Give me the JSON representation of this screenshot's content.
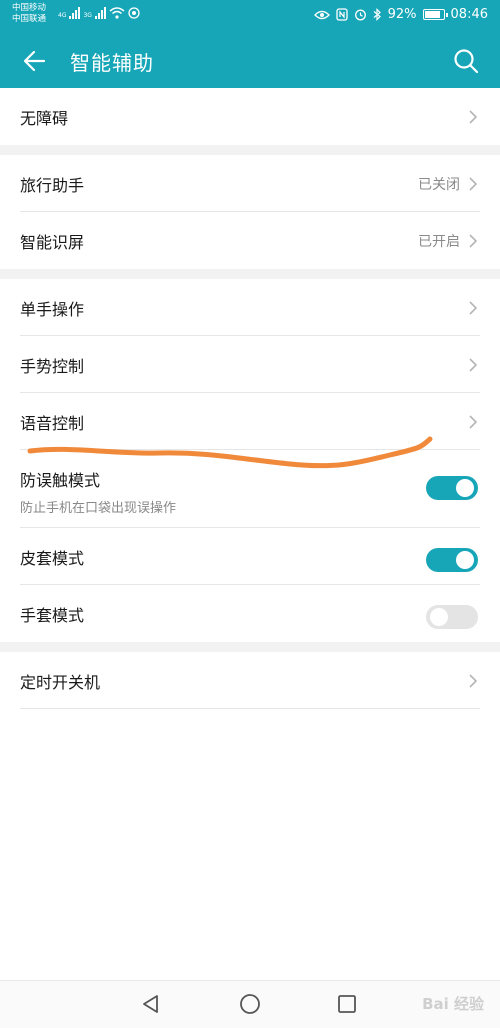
{
  "status_bar": {
    "carrier_1": "中国移动",
    "carrier_2": "中国联通",
    "net_1": "4G",
    "net_2": "3G",
    "battery_text": "92%",
    "time": "08:46"
  },
  "app_bar": {
    "title": "智能辅助",
    "back_icon": "arrow-left",
    "search_icon": "search"
  },
  "sections": [
    {
      "items": [
        {
          "label": "无障碍",
          "type": "link"
        }
      ]
    },
    {
      "items": [
        {
          "label": "旅行助手",
          "value": "已关闭",
          "type": "link"
        },
        {
          "label": "智能识屏",
          "value": "已开启",
          "type": "link"
        }
      ]
    },
    {
      "items": [
        {
          "label": "单手操作",
          "type": "link"
        },
        {
          "label": "手势控制",
          "type": "link"
        },
        {
          "label": "语音控制",
          "type": "link"
        },
        {
          "label": "防误触模式",
          "sublabel": "防止手机在口袋出现误操作",
          "type": "toggle",
          "on": true
        },
        {
          "label": "皮套模式",
          "type": "toggle",
          "on": true
        },
        {
          "label": "手套模式",
          "type": "toggle",
          "on": false
        }
      ]
    },
    {
      "items": [
        {
          "label": "定时开关机",
          "type": "link"
        }
      ]
    }
  ],
  "nav_bar": {
    "watermark": "Bai 经验"
  },
  "colors": {
    "accent": "#17a6b7",
    "annotation": "#f0893a"
  }
}
